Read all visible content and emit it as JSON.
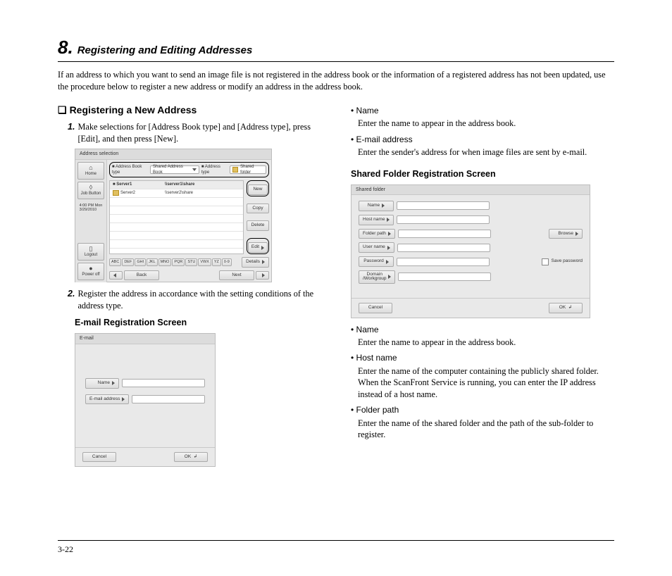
{
  "chapter": {
    "number": "8.",
    "title": "Registering and Editing Addresses"
  },
  "intro": "If an address to which you want to send an image file is not registered in the address book or the information of a registered address has not been updated, use the procedure below to register a new address or modify an address in the address book.",
  "left": {
    "section_marker": "❏",
    "section": "Registering a New Address",
    "step1_num": "1.",
    "step1": "Make selections for [Address Book type] and [Address type], press [Edit], and then press [New].",
    "step2_num": "2.",
    "step2": "Register the address in accordance with the setting conditions of the address type.",
    "email_h": "E-mail Registration Screen"
  },
  "right": {
    "b1_t": "• Name",
    "b1_d": "Enter the name to appear in the address book.",
    "b2_t": "• E-mail address",
    "b2_d": "Enter the sender's address for when image files are sent by e-mail.",
    "shared_h": "Shared Folder Registration Screen",
    "b3_t": "• Name",
    "b3_d": "Enter the name to appear in the address book.",
    "b4_t": "• Host name",
    "b4_d": "Enter the name of the computer containing the publicly shared folder. When the ScanFront Service is running, you can enter the IP address instead of a host name.",
    "b5_t": "• Folder path",
    "b5_d": "Enter the name of the shared folder and the path of the sub-folder to register."
  },
  "page_num": "3-22",
  "fr1": {
    "title": "Address selection",
    "side": {
      "home": "Home",
      "job": "Job Button",
      "time": "4:00 PM Mon\n3/29/2010",
      "logout": "Logout",
      "power": "Power off"
    },
    "filter": {
      "l1": "■ Address Book type",
      "v1": "Shared Address Book",
      "l2": "■ Address type",
      "v2": "Shared folder"
    },
    "table": {
      "h1": "■ Server1",
      "h2": "\\\\server1\\share",
      "r1c1": "Server2",
      "r1c2": "\\\\server2\\share"
    },
    "actions": {
      "new": "New",
      "copy": "Copy",
      "delete": "Delete",
      "edit": "Edit",
      "details": "Details"
    },
    "alpha": [
      "ABC",
      "DEF",
      "GHI",
      "JKL",
      "MNO",
      "PQR",
      "STU",
      "VWX",
      "YZ",
      "0-9"
    ],
    "nav": {
      "back": "Back",
      "next": "Next"
    }
  },
  "fr2": {
    "title": "E-mail",
    "name": "Name",
    "email": "E-mail address",
    "cancel": "Cancel",
    "ok": "OK"
  },
  "fr3": {
    "title": "Shared folder",
    "name": "Name",
    "host": "Host name",
    "folder": "Folder path",
    "user": "User name",
    "pass": "Password",
    "domain": "Domain\n/Workgroup",
    "browse": "Browse",
    "savepw": "Save password",
    "cancel": "Cancel",
    "ok": "OK"
  }
}
